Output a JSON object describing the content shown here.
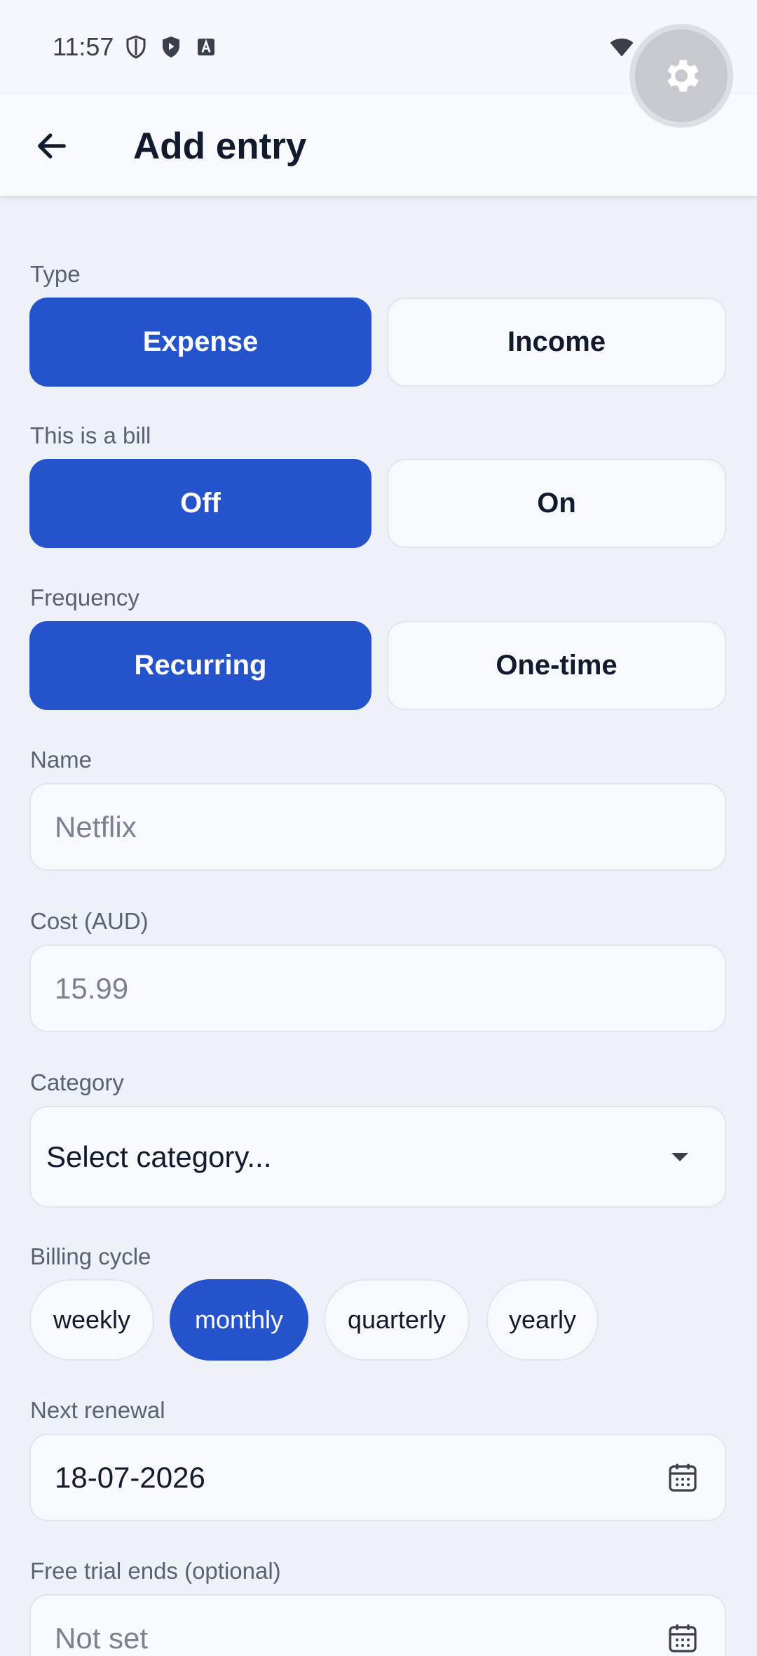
{
  "status_bar": {
    "time": "11:57",
    "icons_left": [
      "shield-outline-icon",
      "play-shield-icon",
      "a-box-icon"
    ],
    "icons_right": [
      "wifi-icon",
      "signal-icon",
      "battery-icon"
    ]
  },
  "app_bar": {
    "title": "Add entry",
    "back_icon": "arrow-left-icon",
    "settings_icon": "gear-icon"
  },
  "type": {
    "label": "Type",
    "options": [
      "Expense",
      "Income"
    ],
    "selected": "Expense"
  },
  "bill": {
    "label": "This is a bill",
    "options": [
      "Off",
      "On"
    ],
    "selected": "Off"
  },
  "frequency": {
    "label": "Frequency",
    "options": [
      "Recurring",
      "One-time"
    ],
    "selected": "Recurring"
  },
  "name": {
    "label": "Name",
    "value": "",
    "placeholder": "Netflix"
  },
  "cost": {
    "label": "Cost (AUD)",
    "value": "",
    "placeholder": "15.99"
  },
  "category": {
    "label": "Category",
    "selected": "Select category..."
  },
  "billing_cycle": {
    "label": "Billing cycle",
    "options": [
      "weekly",
      "monthly",
      "quarterly",
      "yearly"
    ],
    "selected": "monthly"
  },
  "next_renewal": {
    "label": "Next renewal",
    "value": "18-07-2026"
  },
  "free_trial": {
    "label": "Free trial ends (optional)",
    "placeholder": "Not set"
  },
  "colors": {
    "accent": "#2453cc",
    "background": "#eef1f7",
    "surface": "#f8f9fd",
    "text": "#121a2e",
    "muted": "#5a6172"
  }
}
